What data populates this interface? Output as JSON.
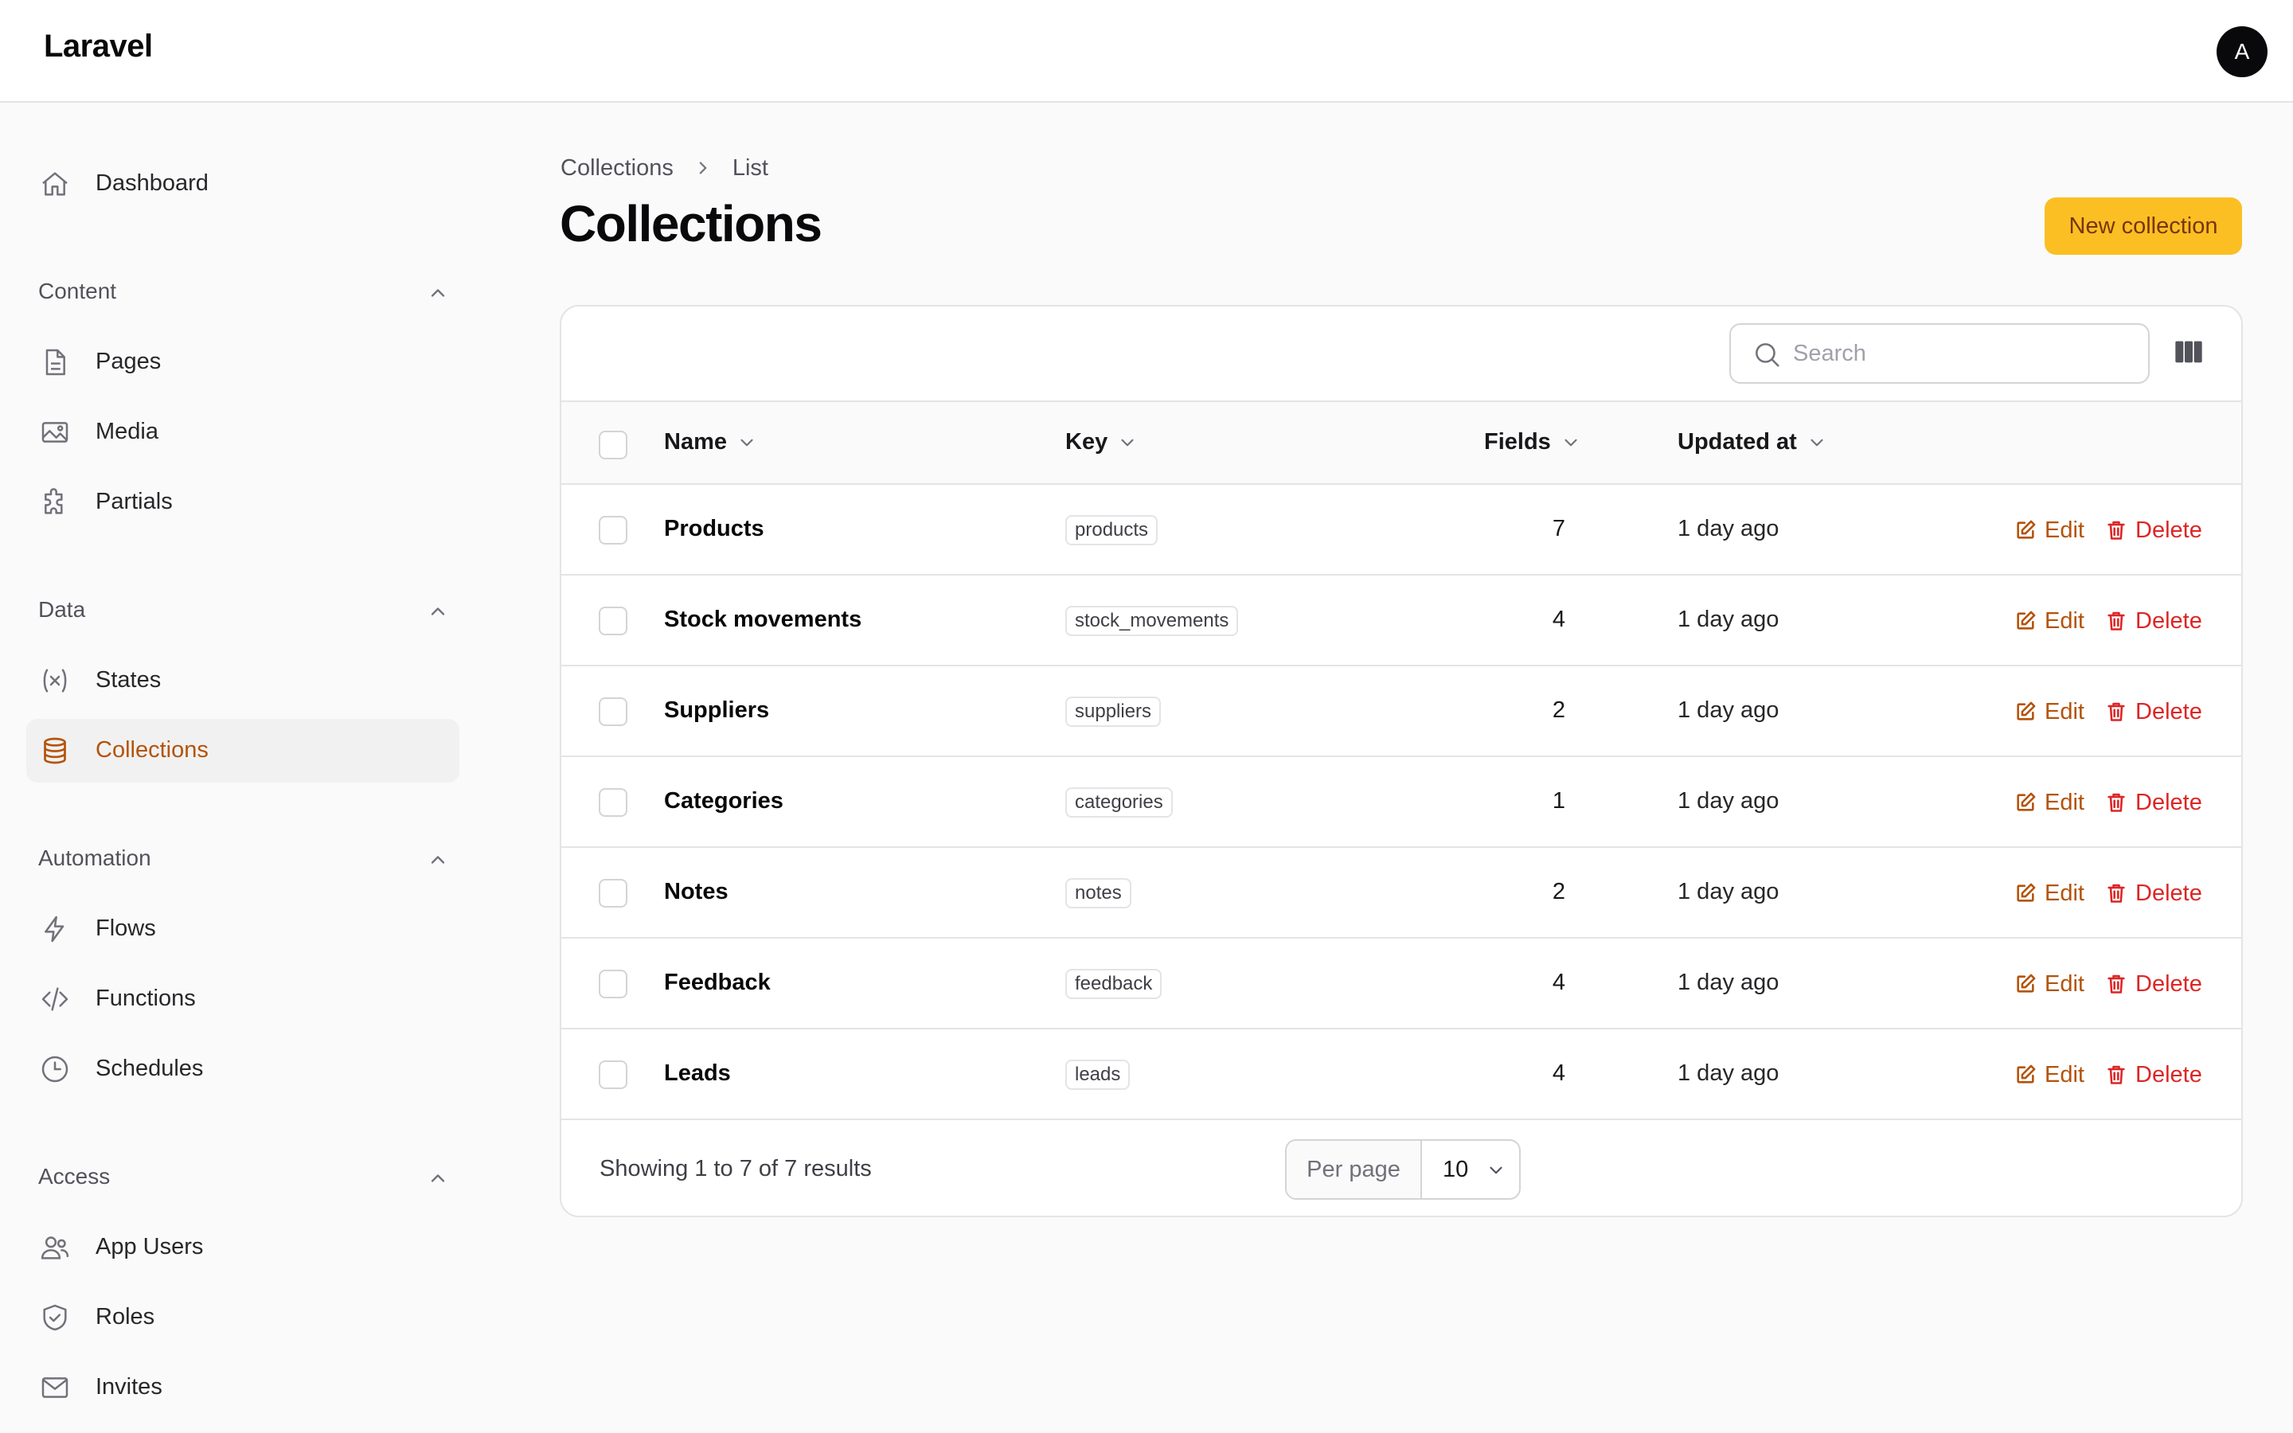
{
  "app": {
    "brand": "Laravel",
    "avatar_initial": "A"
  },
  "sidebar": {
    "dashboard": {
      "label": "Dashboard",
      "icon": "home-icon"
    },
    "groups": [
      {
        "label": "Content",
        "items": [
          {
            "label": "Pages",
            "icon": "file-icon"
          },
          {
            "label": "Media",
            "icon": "image-icon"
          },
          {
            "label": "Partials",
            "icon": "puzzle-icon"
          }
        ]
      },
      {
        "label": "Data",
        "items": [
          {
            "label": "States",
            "icon": "variable-icon"
          },
          {
            "label": "Collections",
            "icon": "database-icon",
            "active": true
          }
        ]
      },
      {
        "label": "Automation",
        "items": [
          {
            "label": "Flows",
            "icon": "bolt-icon"
          },
          {
            "label": "Functions",
            "icon": "code-icon"
          },
          {
            "label": "Schedules",
            "icon": "clock-icon"
          }
        ]
      },
      {
        "label": "Access",
        "items": [
          {
            "label": "App Users",
            "icon": "users-icon"
          },
          {
            "label": "Roles",
            "icon": "shield-icon"
          },
          {
            "label": "Invites",
            "icon": "mail-icon"
          }
        ]
      }
    ]
  },
  "breadcrumb": [
    "Collections",
    "List"
  ],
  "page": {
    "title": "Collections",
    "new_button": "New collection"
  },
  "table": {
    "search_placeholder": "Search",
    "columns": [
      "Name",
      "Key",
      "Fields",
      "Updated at"
    ],
    "rows": [
      {
        "name": "Products",
        "key": "products",
        "fields": "7",
        "updated": "1 day ago"
      },
      {
        "name": "Stock movements",
        "key": "stock_movements",
        "fields": "4",
        "updated": "1 day ago"
      },
      {
        "name": "Suppliers",
        "key": "suppliers",
        "fields": "2",
        "updated": "1 day ago"
      },
      {
        "name": "Categories",
        "key": "categories",
        "fields": "1",
        "updated": "1 day ago"
      },
      {
        "name": "Notes",
        "key": "notes",
        "fields": "2",
        "updated": "1 day ago"
      },
      {
        "name": "Feedback",
        "key": "feedback",
        "fields": "4",
        "updated": "1 day ago"
      },
      {
        "name": "Leads",
        "key": "leads",
        "fields": "4",
        "updated": "1 day ago"
      }
    ],
    "actions": {
      "edit": "Edit",
      "delete": "Delete"
    },
    "footer": {
      "summary": "Showing 1 to 7 of 7 results",
      "per_page_label": "Per page",
      "per_page_value": "10"
    }
  },
  "colors": {
    "accent": "#b45309",
    "primary_button": "#fbbf24",
    "danger": "#dc2626"
  }
}
